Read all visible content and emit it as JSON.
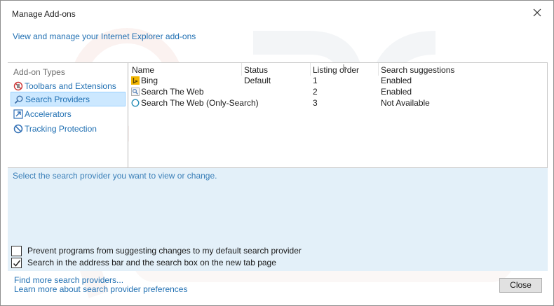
{
  "window": {
    "title": "Manage Add-ons"
  },
  "header": {
    "link": "View and manage your Internet Explorer add-ons"
  },
  "addon_types": {
    "label": "Add-on Types",
    "items": [
      {
        "label": "Toolbars and Extensions",
        "icon": "toolbars-extensions-icon",
        "selected": false
      },
      {
        "label": "Search Providers",
        "icon": "search-providers-icon",
        "selected": true
      },
      {
        "label": "Accelerators",
        "icon": "accelerators-icon",
        "selected": false
      },
      {
        "label": "Tracking Protection",
        "icon": "tracking-protection-icon",
        "selected": false
      }
    ]
  },
  "table": {
    "columns": [
      "Name",
      "Status",
      "Listing order",
      "Search suggestions"
    ],
    "rows": [
      {
        "name": "Bing",
        "icon": "bing-icon",
        "status": "Default",
        "order": "1",
        "suggestions": "Enabled"
      },
      {
        "name": "Search The Web",
        "icon": "search-the-web-icon",
        "status": "",
        "order": "2",
        "suggestions": "Enabled"
      },
      {
        "name": "Search The Web (Only-Search)",
        "icon": "only-search-icon",
        "status": "",
        "order": "3",
        "suggestions": "Not Available"
      }
    ]
  },
  "detail": {
    "hint": "Select the search provider you want to view or change.",
    "checkboxes": [
      {
        "label": "Prevent programs from suggesting changes to my default search provider",
        "checked": false
      },
      {
        "label": "Search in the address bar and the search box on the new tab page",
        "checked": true
      }
    ]
  },
  "footer": {
    "links": [
      "Find more search providers...",
      "Learn more about search provider preferences"
    ],
    "close_label": "Close"
  },
  "colors": {
    "link": "#1f6fb2",
    "selection": "#cce8ff",
    "detail_bg": "#e3f0f9"
  }
}
